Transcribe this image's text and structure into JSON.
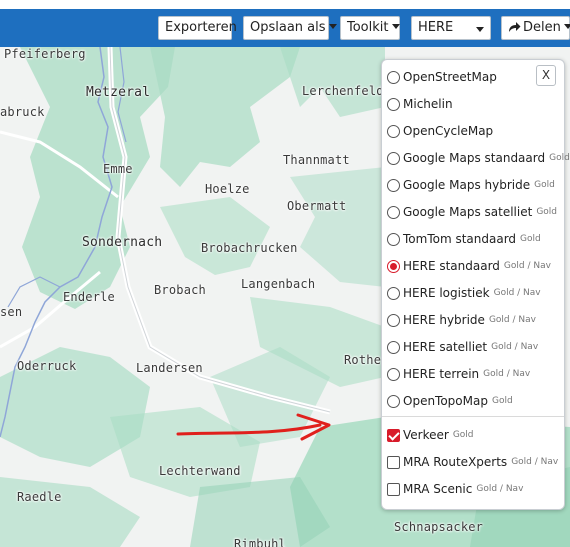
{
  "toolbar": {
    "export_label": "Exporteren",
    "saveas_label": "Opslaan als",
    "toolkit_label": "Toolkit",
    "map_select_value": "HERE",
    "share_label": "Delen"
  },
  "map": {
    "places": [
      "Pfeiferberg",
      "Metzeral",
      "Lerchenfeld",
      "abruck",
      "Thannmatt",
      "Emme",
      "Hoelze",
      "Obermatt",
      "Sondernach",
      "Brobachrucken",
      "Enderle",
      "Brobach",
      "Langenbach",
      "sen",
      "Oderruck",
      "Landersen",
      "Rothe",
      "Lechterwand",
      "Raedle",
      "Schnapsacker",
      "Rimbuhl"
    ],
    "colors": {
      "forest": "#a8dcc3",
      "forest_dark": "#94d2b6",
      "river": "#8fa6d8",
      "road": "#d0d4d8",
      "arrow": "#e0201c"
    }
  },
  "layers": {
    "close_label": "X",
    "base": [
      {
        "label": "OpenStreetMap",
        "badge": "",
        "selected": false
      },
      {
        "label": "Michelin",
        "badge": "",
        "selected": false
      },
      {
        "label": "OpenCycleMap",
        "badge": "",
        "selected": false
      },
      {
        "label": "Google Maps standaard",
        "badge": "Gold",
        "selected": false
      },
      {
        "label": "Google Maps hybride",
        "badge": "Gold",
        "selected": false
      },
      {
        "label": "Google Maps satelliet",
        "badge": "Gold",
        "selected": false
      },
      {
        "label": "TomTom standaard",
        "badge": "Gold",
        "selected": false
      },
      {
        "label": "HERE standaard",
        "badge": "Gold / Nav",
        "selected": true
      },
      {
        "label": "HERE logistiek",
        "badge": "Gold / Nav",
        "selected": false
      },
      {
        "label": "HERE hybride",
        "badge": "Gold / Nav",
        "selected": false
      },
      {
        "label": "HERE satelliet",
        "badge": "Gold / Nav",
        "selected": false
      },
      {
        "label": "HERE terrein",
        "badge": "Gold / Nav",
        "selected": false
      },
      {
        "label": "OpenTopoMap",
        "badge": "Gold",
        "selected": false
      }
    ],
    "overlays": [
      {
        "label": "Verkeer",
        "badge": "Gold",
        "checked": true
      },
      {
        "label": "MRA RouteXperts",
        "badge": "Gold / Nav",
        "checked": false
      },
      {
        "label": "MRA Scenic",
        "badge": "Gold / Nav",
        "checked": false
      }
    ]
  }
}
